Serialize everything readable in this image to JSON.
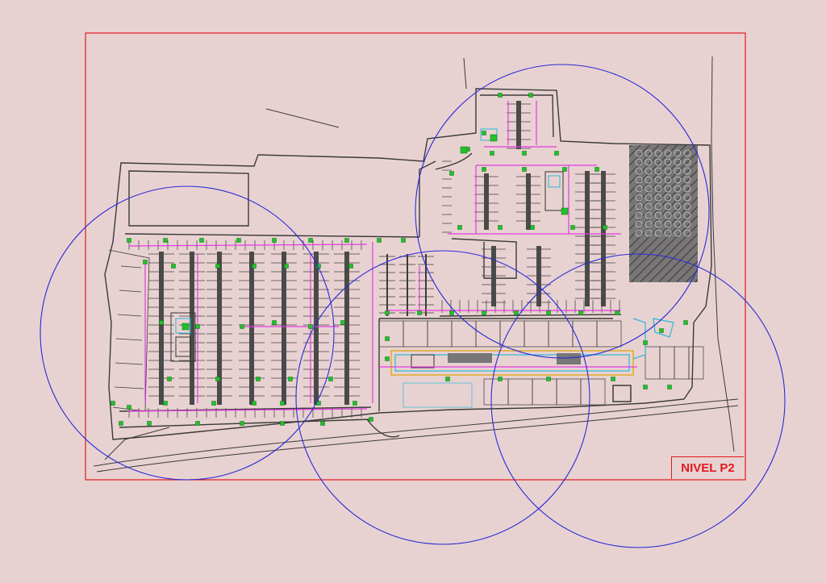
{
  "drawing": {
    "level_label": "NIVEL P2",
    "colors": {
      "background": "#e8d2d1",
      "frame": "#e0191e",
      "coverage_circle": "#2b2bd6",
      "walls": "#3a3a3a",
      "device_green": "#22c12b",
      "route_magenta": "#e23ce0",
      "route_cyan": "#2bb8d8",
      "hatch_area": "#5a5a5a"
    },
    "coverage_circles": [
      {
        "name": "coverage-circle-west"
      },
      {
        "name": "coverage-circle-north-east"
      },
      {
        "name": "coverage-circle-south-center"
      },
      {
        "name": "coverage-circle-south-east"
      }
    ]
  }
}
